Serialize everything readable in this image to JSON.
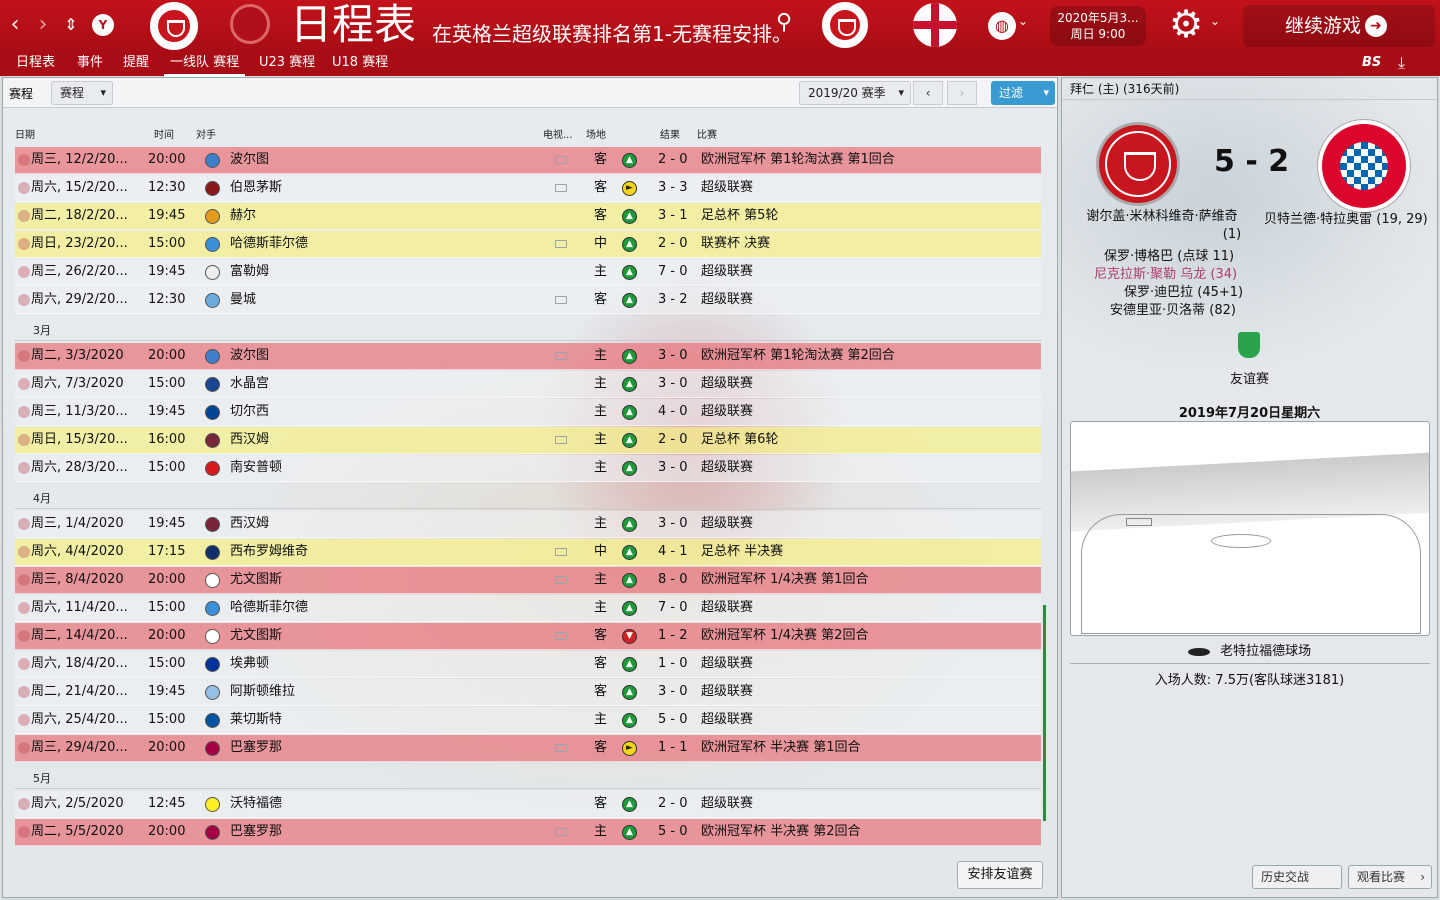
{
  "header": {
    "title": "日程表",
    "subtitle": "在英格兰超级联赛排名第1-无赛程安排。",
    "date_line1": "2020年5月3...",
    "date_line2": "周日 9:00",
    "continue_label": "继续游戏"
  },
  "tabs": [
    {
      "label": "日程表"
    },
    {
      "label": "事件"
    },
    {
      "label": "提醒"
    },
    {
      "label": "一线队 赛程"
    },
    {
      "label": "U23 赛程"
    },
    {
      "label": "U18 赛程"
    }
  ],
  "filterbar": {
    "label": "赛程",
    "type_select": "赛程",
    "season_select": "2019/20 赛季",
    "filter_label": "过滤"
  },
  "columns": {
    "date": "日期",
    "time": "时间",
    "opponent": "对手",
    "tv": "电视...",
    "venue": "场地",
    "result": "结果",
    "competition": "比赛"
  },
  "months": {
    "mar": "3月",
    "apr": "4月",
    "may": "5月"
  },
  "fixtures": [
    {
      "date": "周三, 12/2/20...",
      "time": "20:00",
      "opponent": "波尔图",
      "tv": true,
      "venue": "客",
      "outcome": "W",
      "score": "2 - 0",
      "competition": "欧洲冠军杯 第1轮淘汰赛 第1回合",
      "style": "red",
      "badge": "#3d7fc9"
    },
    {
      "date": "周六, 15/2/20...",
      "time": "12:30",
      "opponent": "伯恩茅斯",
      "tv": true,
      "venue": "客",
      "outcome": "D",
      "score": "3 - 3",
      "competition": "超级联赛",
      "style": "plain",
      "badge": "#8a1a1a"
    },
    {
      "date": "周二, 18/2/20...",
      "time": "19:45",
      "opponent": "赫尔",
      "tv": false,
      "venue": "客",
      "outcome": "W",
      "score": "3 - 1",
      "competition": "足总杯 第5轮",
      "style": "yellow",
      "badge": "#e39b1c"
    },
    {
      "date": "周日, 23/2/20...",
      "time": "15:00",
      "opponent": "哈德斯菲尔德",
      "tv": true,
      "venue": "中",
      "outcome": "W",
      "score": "2 - 0",
      "competition": "联赛杯 决赛",
      "style": "yellow",
      "badge": "#3b8ed8"
    },
    {
      "date": "周三, 26/2/20...",
      "time": "19:45",
      "opponent": "富勒姆",
      "tv": false,
      "venue": "主",
      "outcome": "W",
      "score": "7 - 0",
      "competition": "超级联赛",
      "style": "plain",
      "badge": "#eeeeee"
    },
    {
      "date": "周六, 29/2/20...",
      "time": "12:30",
      "opponent": "曼城",
      "tv": true,
      "venue": "客",
      "outcome": "W",
      "score": "3 - 2",
      "competition": "超级联赛",
      "style": "plain",
      "badge": "#6cabdd"
    },
    {
      "date": "周二, 3/3/2020",
      "time": "20:00",
      "opponent": "波尔图",
      "tv": true,
      "venue": "主",
      "outcome": "W",
      "score": "3 - 0",
      "competition": "欧洲冠军杯 第1轮淘汰赛 第2回合",
      "style": "red",
      "badge": "#3d7fc9"
    },
    {
      "date": "周六, 7/3/2020",
      "time": "15:00",
      "opponent": "水晶宫",
      "tv": false,
      "venue": "主",
      "outcome": "W",
      "score": "3 - 0",
      "competition": "超级联赛",
      "style": "plain",
      "badge": "#1b458f"
    },
    {
      "date": "周三, 11/3/20...",
      "time": "19:45",
      "opponent": "切尔西",
      "tv": false,
      "venue": "主",
      "outcome": "W",
      "score": "4 - 0",
      "competition": "超级联赛",
      "style": "plain",
      "badge": "#034694"
    },
    {
      "date": "周日, 15/3/20...",
      "time": "16:00",
      "opponent": "西汉姆",
      "tv": true,
      "venue": "主",
      "outcome": "W",
      "score": "2 - 0",
      "competition": "足总杯 第6轮",
      "style": "yellow",
      "badge": "#7a263a"
    },
    {
      "date": "周六, 28/3/20...",
      "time": "15:00",
      "opponent": "南安普顿",
      "tv": false,
      "venue": "主",
      "outcome": "W",
      "score": "3 - 0",
      "competition": "超级联赛",
      "style": "plain",
      "badge": "#d71920"
    },
    {
      "date": "周三, 1/4/2020",
      "time": "19:45",
      "opponent": "西汉姆",
      "tv": false,
      "venue": "主",
      "outcome": "W",
      "score": "3 - 0",
      "competition": "超级联赛",
      "style": "plain",
      "badge": "#7a263a"
    },
    {
      "date": "周六, 4/4/2020",
      "time": "17:15",
      "opponent": "西布罗姆维奇",
      "tv": true,
      "venue": "中",
      "outcome": "W",
      "score": "4 - 1",
      "competition": "足总杯 半决赛",
      "style": "yellow",
      "badge": "#122f67"
    },
    {
      "date": "周三, 8/4/2020",
      "time": "20:00",
      "opponent": "尤文图斯",
      "tv": true,
      "venue": "主",
      "outcome": "W",
      "score": "8 - 0",
      "competition": "欧洲冠军杯 1/4决赛 第1回合",
      "style": "red",
      "badge": "#ffffff"
    },
    {
      "date": "周六, 11/4/20...",
      "time": "15:00",
      "opponent": "哈德斯菲尔德",
      "tv": false,
      "venue": "主",
      "outcome": "W",
      "score": "7 - 0",
      "competition": "超级联赛",
      "style": "plain",
      "badge": "#3b8ed8"
    },
    {
      "date": "周二, 14/4/20...",
      "time": "20:00",
      "opponent": "尤文图斯",
      "tv": true,
      "venue": "客",
      "outcome": "L",
      "score": "1 - 2",
      "competition": "欧洲冠军杯 1/4决赛 第2回合",
      "style": "red",
      "badge": "#ffffff"
    },
    {
      "date": "周六, 18/4/20...",
      "time": "15:00",
      "opponent": "埃弗顿",
      "tv": false,
      "venue": "客",
      "outcome": "W",
      "score": "1 - 0",
      "competition": "超级联赛",
      "style": "plain",
      "badge": "#003399"
    },
    {
      "date": "周二, 21/4/20...",
      "time": "19:45",
      "opponent": "阿斯顿维拉",
      "tv": false,
      "venue": "客",
      "outcome": "W",
      "score": "3 - 0",
      "competition": "超级联赛",
      "style": "plain",
      "badge": "#95bfe5"
    },
    {
      "date": "周六, 25/4/20...",
      "time": "15:00",
      "opponent": "莱切斯特",
      "tv": false,
      "venue": "主",
      "outcome": "W",
      "score": "5 - 0",
      "competition": "超级联赛",
      "style": "plain",
      "badge": "#0053a0"
    },
    {
      "date": "周三, 29/4/20...",
      "time": "20:00",
      "opponent": "巴塞罗那",
      "tv": true,
      "venue": "客",
      "outcome": "D",
      "score": "1 - 1",
      "competition": "欧洲冠军杯 半决赛 第1回合",
      "style": "red",
      "badge": "#a50044"
    },
    {
      "date": "周六, 2/5/2020",
      "time": "12:45",
      "opponent": "沃特福德",
      "tv": false,
      "venue": "客",
      "outcome": "W",
      "score": "2 - 0",
      "competition": "超级联赛",
      "style": "plain",
      "badge": "#fbee23"
    },
    {
      "date": "周二, 5/5/2020",
      "time": "20:00",
      "opponent": "巴塞罗那",
      "tv": true,
      "venue": "主",
      "outcome": "W",
      "score": "5 - 0",
      "competition": "欧洲冠军杯 半决赛 第2回合",
      "style": "red",
      "badge": "#a50044"
    }
  ],
  "arrange_friendly_label": "安排友谊赛",
  "side": {
    "heading": "拜仁 (主) (316天前)",
    "score": "5 - 2",
    "home_scorers_line1": "谢尔盖·米林科维奇·萨维奇",
    "home_scorers_line1b": "(1)",
    "away_scorers": "贝特兰德·特拉奥雷 (19, 29)",
    "scorers": [
      {
        "text": "保罗·博格巴 (点球 11)",
        "pink": false
      },
      {
        "text": "尼克拉斯·聚勒 乌龙 (34)",
        "pink": true
      },
      {
        "text": "保罗·迪巴拉 (45+1)",
        "pink": false
      },
      {
        "text": "安德里亚·贝洛蒂 (82)",
        "pink": false
      }
    ],
    "competition": "友谊赛",
    "match_date": "2019年7月20日星期六",
    "stadium": "老特拉福德球场",
    "attendance": "入场人数: 7.5万(客队球迷3181)",
    "history_btn": "历史交战",
    "view_match_btn": "观看比赛"
  },
  "colors": {
    "header_red": "#b3101a",
    "win": "#1e9a3a",
    "draw": "#f2d41a",
    "loss": "#d32020",
    "filter_blue": "#3a9bd3"
  }
}
